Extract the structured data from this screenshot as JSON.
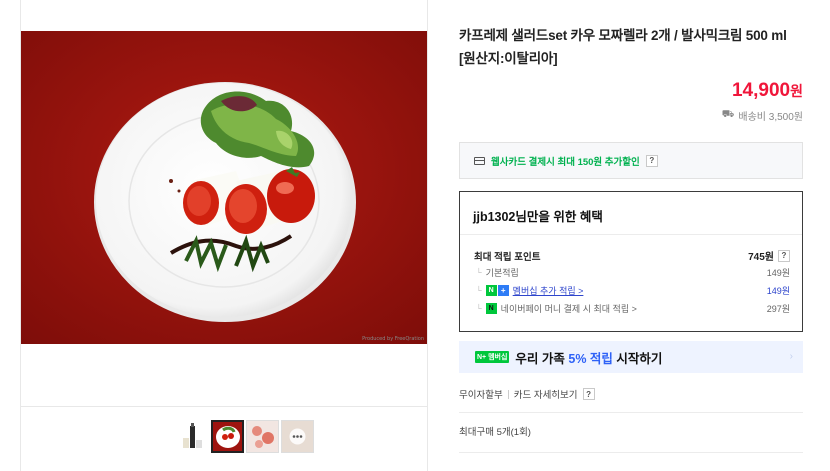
{
  "product": {
    "title": "카프레제 샐러드set 카우 모짜렐라 2개 / 발사믹크림 500 ml [원산지:이탈리아]",
    "price": "14,900",
    "price_unit": "원",
    "shipping": "배송비 3,500원"
  },
  "image": {
    "credit": "Produced by FreeQration"
  },
  "card_promo": {
    "text": "웹사카드 결제시 최대 150원 추가할인",
    "help": "?"
  },
  "benefit": {
    "title": "jjb1302님만을 위한 혜택",
    "max_points_label": "최대 적립 포인트",
    "max_points_value": "745원",
    "rows": [
      {
        "label": "기본적립",
        "value": "149원"
      },
      {
        "label": "멤버십 추가 적립 >",
        "value": "149원"
      },
      {
        "label": "네이버페이 머니 결제 시 최대 적립 >",
        "value": "297원"
      }
    ],
    "badge_n": "N",
    "badge_plus": "+",
    "badge_pay": "N"
  },
  "promo": {
    "badge": "N+ 멤버십",
    "text_before": "우리 가족 ",
    "highlight": "5% 적립",
    "text_after": " 시작하기"
  },
  "payment": {
    "installment": "무이자할부",
    "card_detail": "카드 자세히보기",
    "help": "?"
  },
  "limit": "최대구매 5개(1회)",
  "colors": {
    "price": "#f0163a",
    "naver_green": "#00c73c",
    "link_blue": "#2e45cc",
    "promo_bg": "#eef3ff"
  }
}
